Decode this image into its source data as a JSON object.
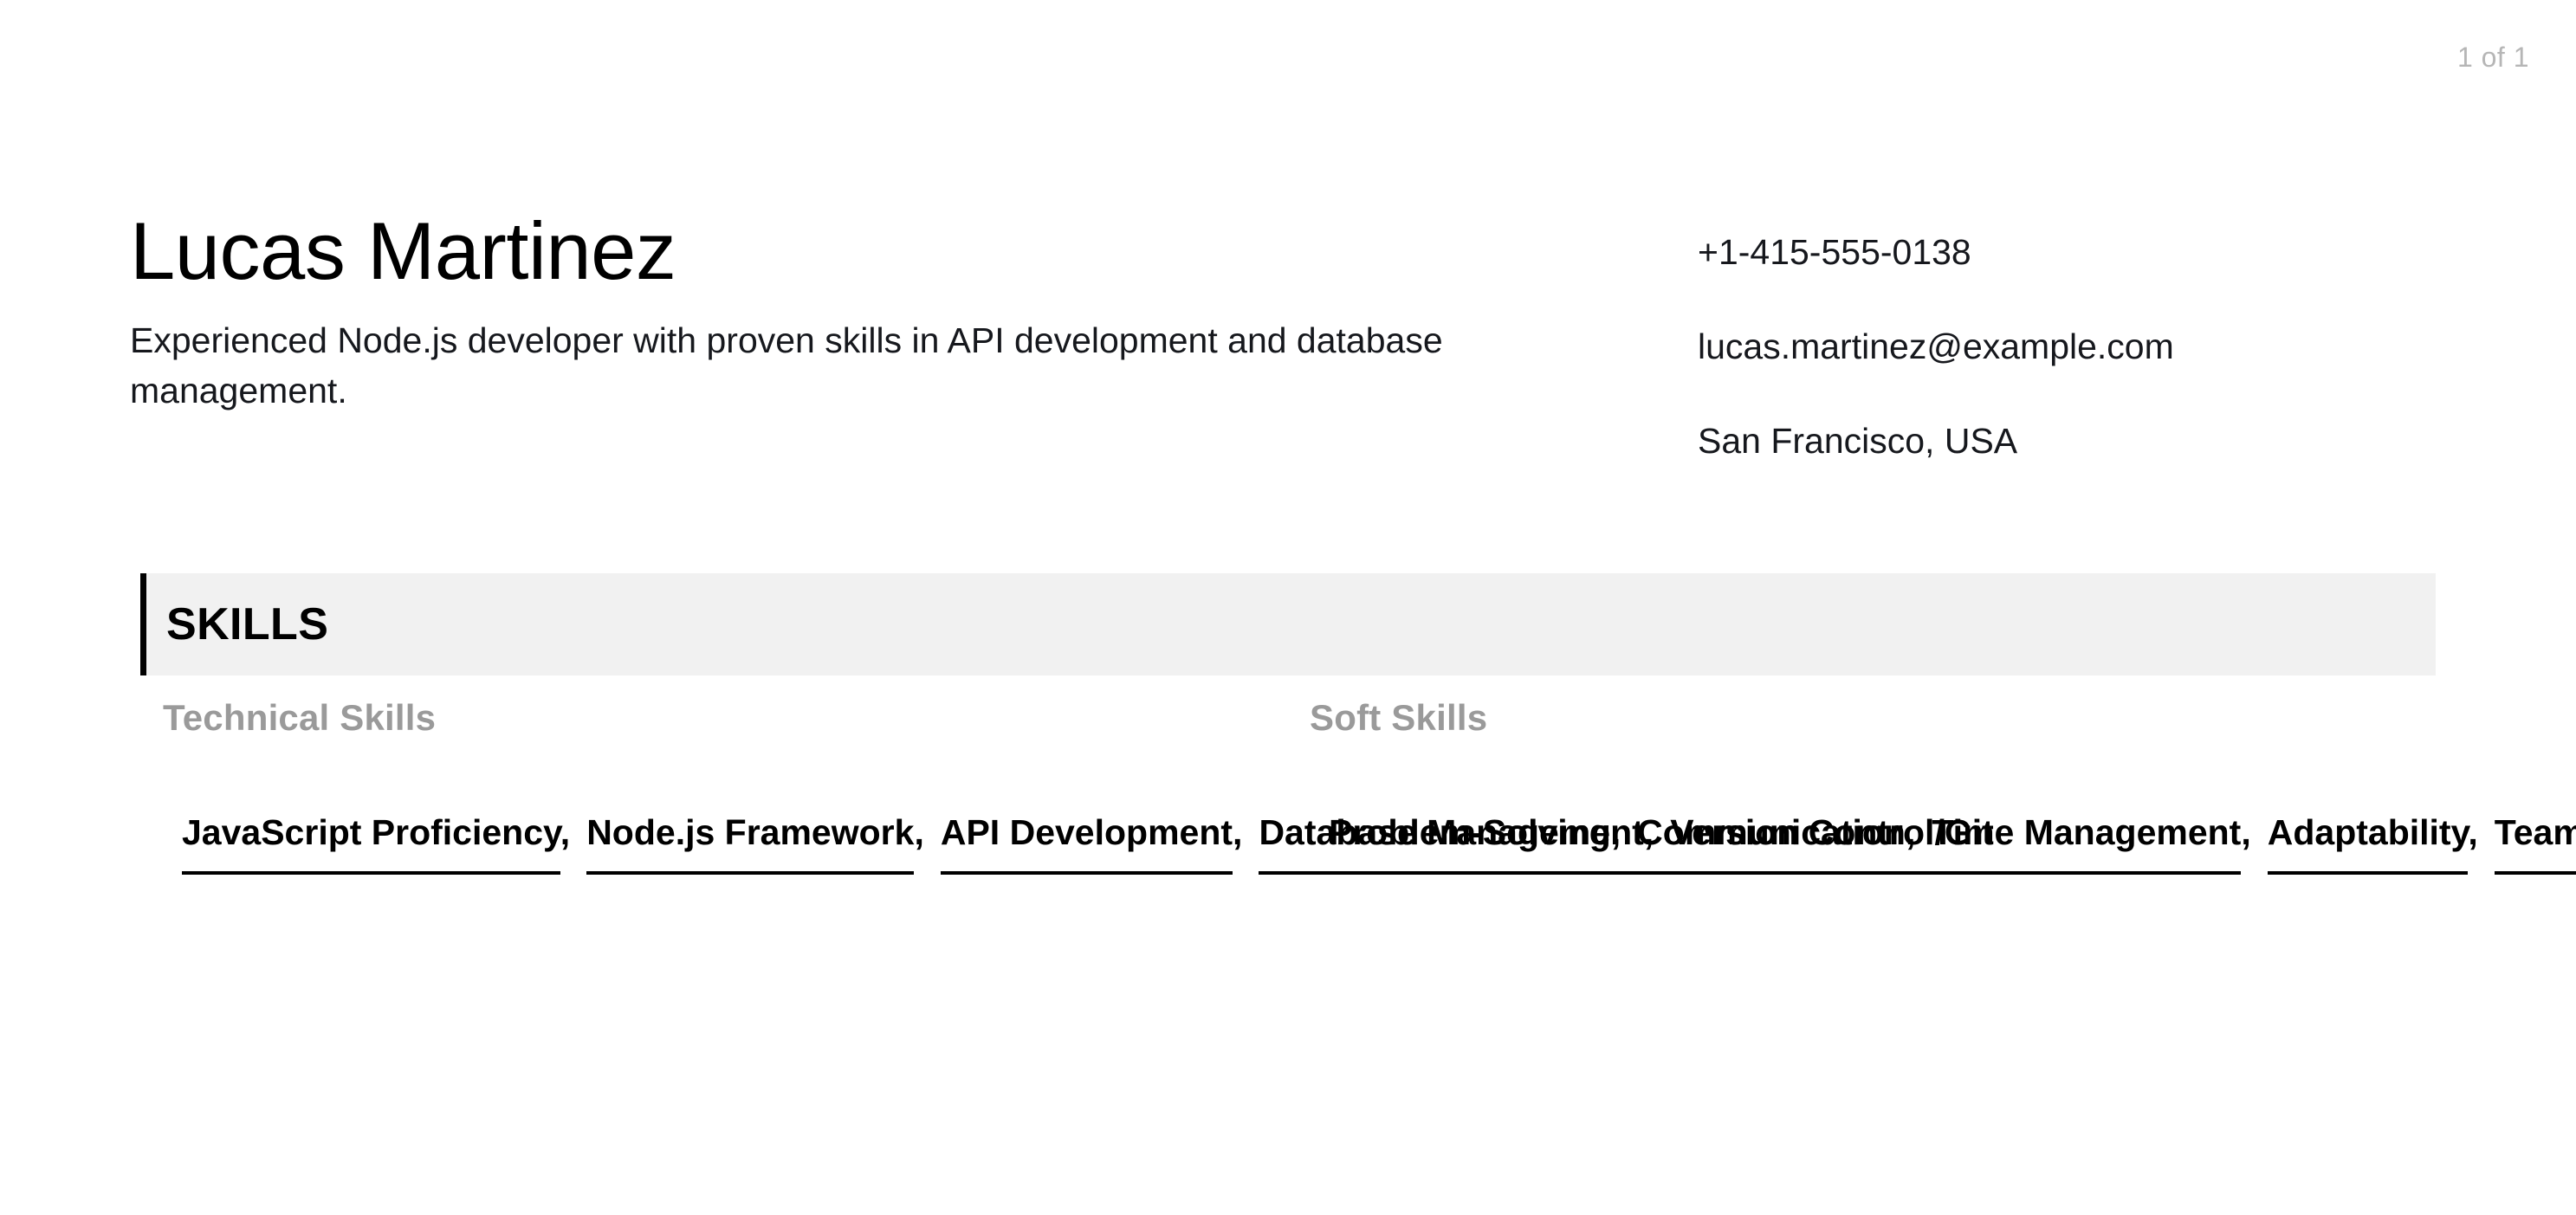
{
  "document": {
    "page_indicator": "1 of 1",
    "background_color": "#ffffff"
  },
  "header": {
    "full_name": "Lucas Martinez",
    "summary": "Experienced Node.js developer with proven skills in API development and database management.",
    "contact": {
      "phone": "+1-415-555-0138",
      "email": "lucas.martinez@example.com",
      "location": "San Francisco, USA"
    }
  },
  "sections": [
    {
      "title": "SKILLS",
      "accent_color": "#000000",
      "bar_color": "#f1f1f1",
      "groups": [
        {
          "heading": "Technical Skills",
          "heading_color": "#9a9a9a",
          "items": [
            "JavaScript Proficiency",
            "Node.js Framework",
            "API Development",
            "Database Management",
            "Version Control/Git"
          ],
          "separator": ","
        },
        {
          "heading": "Soft Skills",
          "heading_color": "#9a9a9a",
          "items": [
            "Problem-Solving",
            "Communication",
            "Time Management",
            "Adaptability",
            "Team Collaboration"
          ],
          "separator": ","
        }
      ]
    }
  ]
}
